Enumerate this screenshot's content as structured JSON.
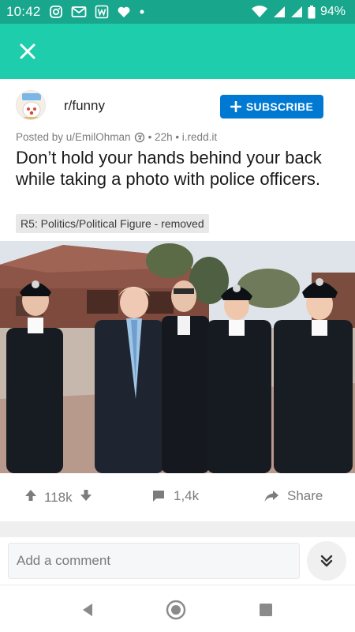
{
  "status_bar": {
    "time": "10:42",
    "battery": "94%",
    "left_icons": [
      "instagram-icon",
      "gmail-icon",
      "word-icon",
      "heart-icon",
      "dot-icon"
    ],
    "right_icons": [
      "wifi-icon",
      "signal-icon",
      "signal-icon",
      "battery-icon"
    ]
  },
  "toolbar": {
    "close_icon": "close-icon"
  },
  "post": {
    "subreddit": "r/funny",
    "subscribe_label": "SUBSCRIBE",
    "posted_by_prefix": "Posted by u/EmilOhman",
    "meta": "• 22h • i.redd.it",
    "title": "Don’t hold your hands behind your back while taking a photo with police officers.",
    "flair": "R5: Politics/Political Figure - removed"
  },
  "actions": {
    "upvotes": "118k",
    "comments": "1,4k",
    "share_label": "Share"
  },
  "comment_bar": {
    "placeholder": "Add a comment"
  },
  "colors": {
    "status_bar": "#18a68c",
    "toolbar": "#1ecdac",
    "subscribe": "#0079d3"
  }
}
